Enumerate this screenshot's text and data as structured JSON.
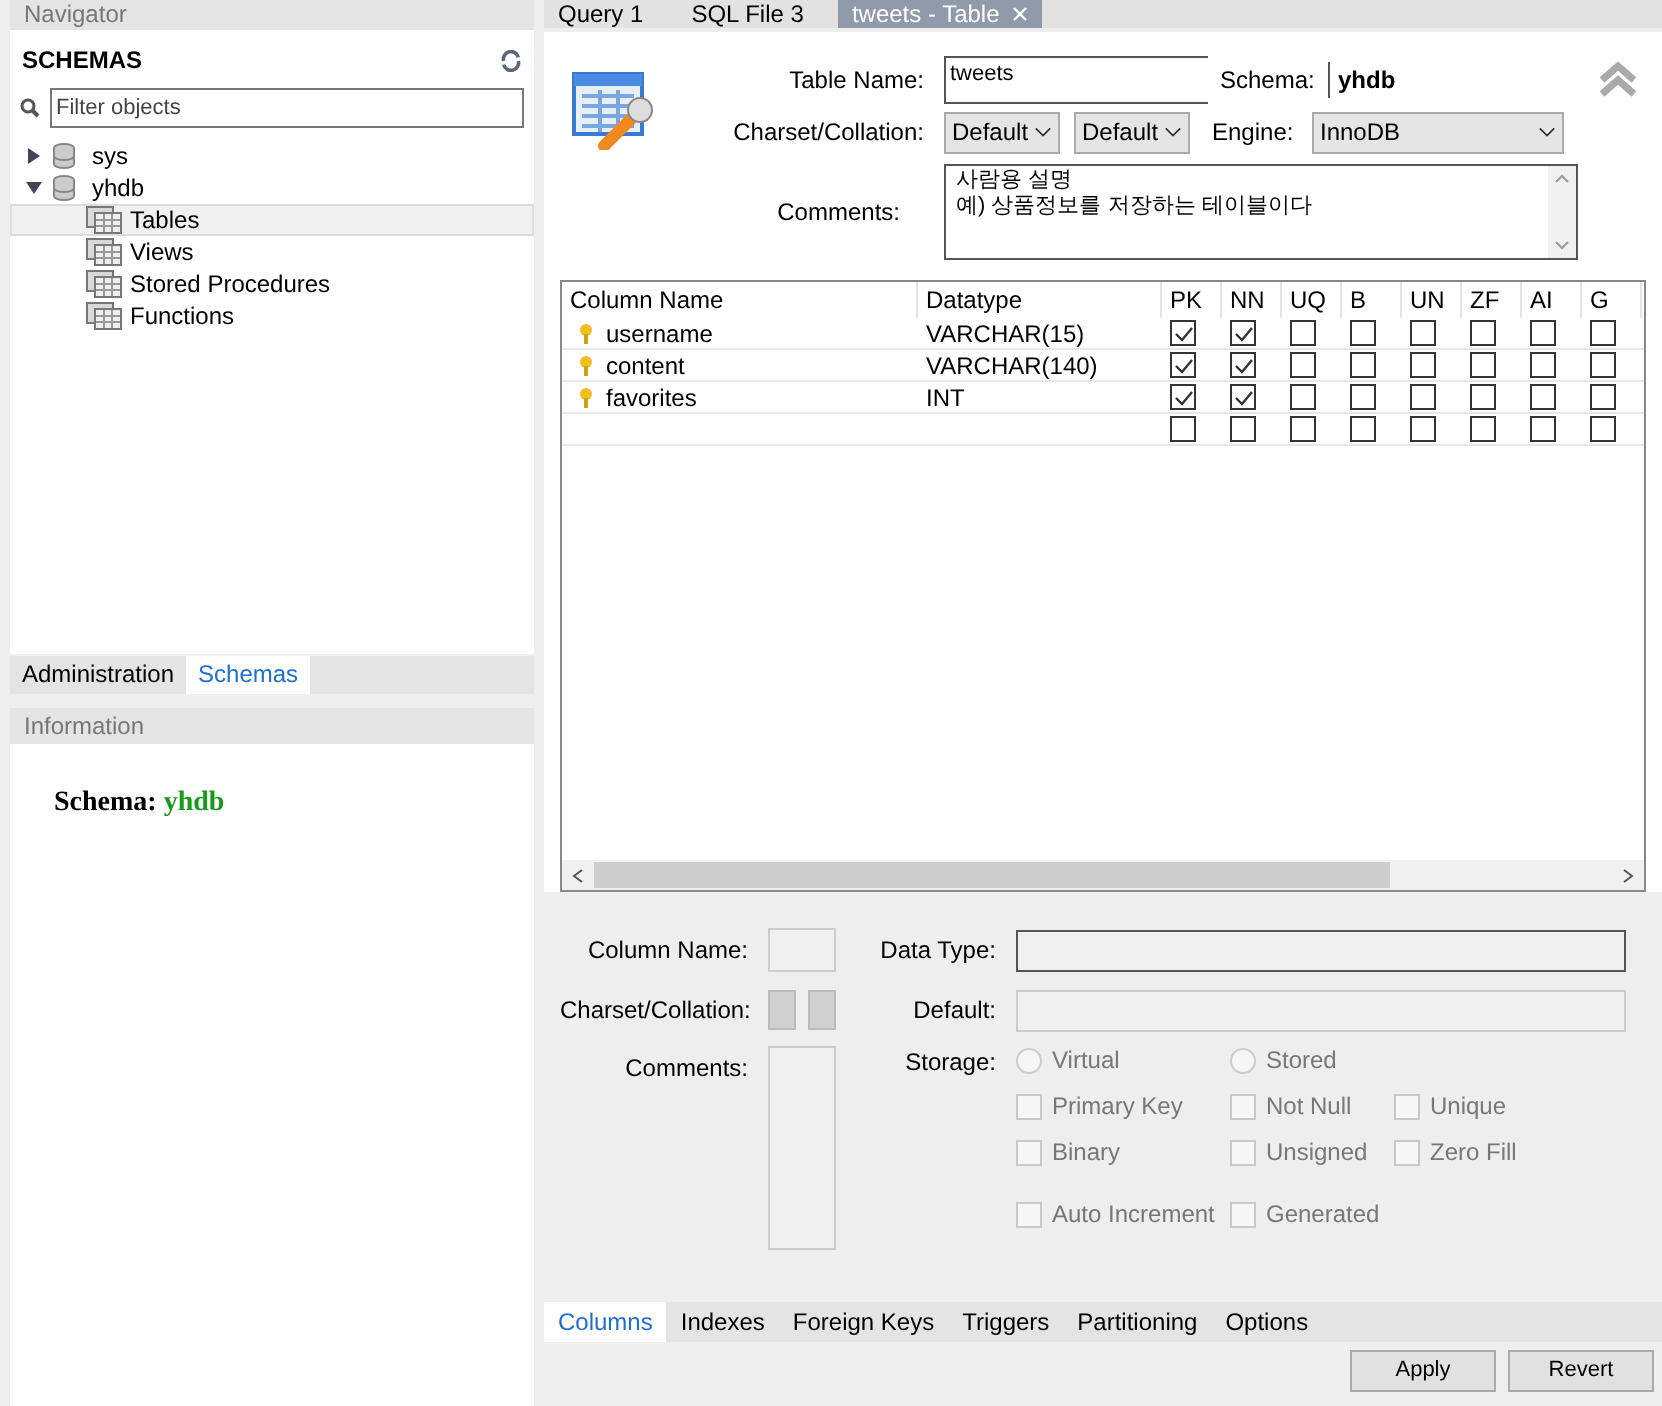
{
  "navigator": {
    "title": "Navigator",
    "schemas_label": "SCHEMAS",
    "filter": {
      "placeholder": "Filter objects"
    },
    "tree": [
      {
        "label": "sys",
        "expanded": false
      },
      {
        "label": "yhdb",
        "expanded": true,
        "children": [
          {
            "label": "Tables",
            "selected": true
          },
          {
            "label": "Views",
            "selected": false
          },
          {
            "label": "Stored Procedures",
            "selected": false
          },
          {
            "label": "Functions",
            "selected": false
          }
        ]
      }
    ],
    "tabs": [
      {
        "label": "Administration",
        "selected": false
      },
      {
        "label": "Schemas",
        "selected": true
      }
    ],
    "information": {
      "title": "Information",
      "schema_label": "Schema:",
      "schema_value": "yhdb"
    }
  },
  "editor_tabs": [
    {
      "label": "Query 1",
      "selected": false,
      "closable": false
    },
    {
      "label": "SQL File 3",
      "selected": false,
      "closable": false
    },
    {
      "label": "tweets - Table",
      "selected": true,
      "closable": true
    }
  ],
  "table_form": {
    "table_name_label": "Table Name:",
    "table_name": "tweets",
    "schema_label": "Schema:",
    "schema": "yhdb",
    "charset_label": "Charset/Collation:",
    "charset": "Default",
    "collation": "Default",
    "engine_label": "Engine:",
    "engine": "InnoDB",
    "comments_label": "Comments:",
    "comments": "사람용 설명\n예) 상품정보를 저장하는 테이블이다"
  },
  "columns_grid": {
    "headers": [
      "Column Name",
      "Datatype",
      "PK",
      "NN",
      "UQ",
      "B",
      "UN",
      "ZF",
      "AI",
      "G"
    ],
    "rows": [
      {
        "kind": "column",
        "name": "username",
        "datatype": "VARCHAR(15)",
        "flags": [
          true,
          true,
          false,
          false,
          false,
          false,
          false,
          false
        ]
      },
      {
        "kind": "column",
        "name": "content",
        "datatype": "VARCHAR(140)",
        "flags": [
          true,
          true,
          false,
          false,
          false,
          false,
          false,
          false
        ]
      },
      {
        "kind": "column",
        "name": "favorites",
        "datatype": "INT",
        "flags": [
          true,
          true,
          false,
          false,
          false,
          false,
          false,
          false
        ]
      },
      {
        "kind": "new",
        "flags": [
          false,
          false,
          false,
          false,
          false,
          false,
          false,
          false
        ]
      }
    ]
  },
  "column_details": {
    "disabled": true,
    "column_name_label": "Column Name:",
    "charset_label": "Charset/Collation:",
    "comments_label": "Comments:",
    "data_type_label": "Data Type:",
    "default_label": "Default:",
    "storage_label": "Storage:",
    "storage": [
      {
        "label": "Virtual",
        "selected": false
      },
      {
        "label": "Stored",
        "selected": false
      }
    ],
    "options": [
      {
        "label": "Primary Key",
        "checked": false
      },
      {
        "label": "Not Null",
        "checked": false
      },
      {
        "label": "Unique",
        "checked": false
      },
      {
        "label": "Binary",
        "checked": false
      },
      {
        "label": "Unsigned",
        "checked": false
      },
      {
        "label": "Zero Fill",
        "checked": false
      },
      {
        "label": "Auto Increment",
        "checked": false
      },
      {
        "label": "Generated",
        "checked": false
      }
    ]
  },
  "bottom_tabs": [
    {
      "label": "Columns",
      "selected": true
    },
    {
      "label": "Indexes",
      "selected": false
    },
    {
      "label": "Foreign Keys",
      "selected": false
    },
    {
      "label": "Triggers",
      "selected": false
    },
    {
      "label": "Partitioning",
      "selected": false
    },
    {
      "label": "Options",
      "selected": false
    }
  ],
  "buttons": [
    "Apply",
    "Revert"
  ]
}
